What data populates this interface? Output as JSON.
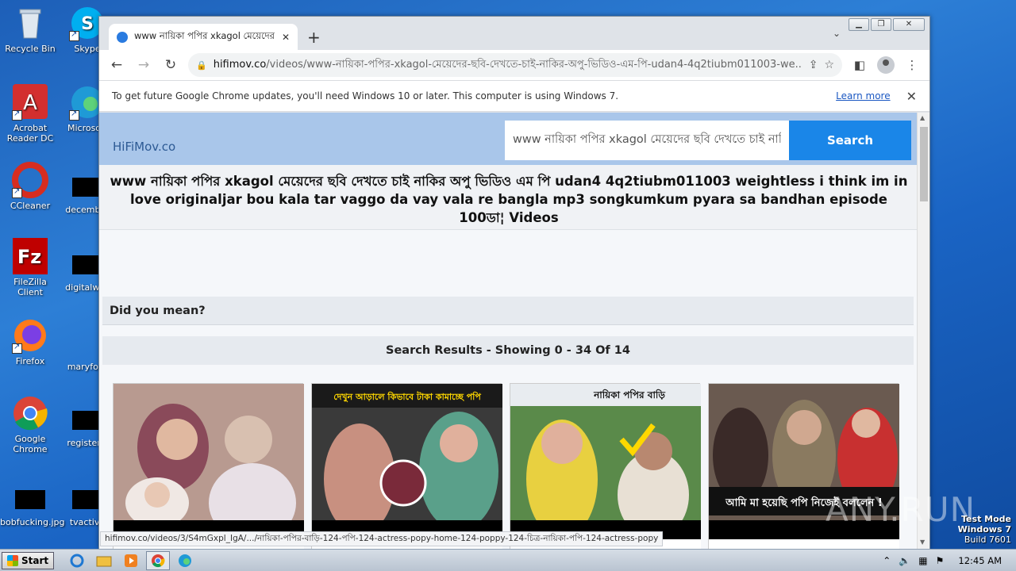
{
  "desktop": {
    "icons": [
      {
        "label": "Recycle Bin"
      },
      {
        "label": "Acrobat Reader DC"
      },
      {
        "label": "CCleaner"
      },
      {
        "label": "FileZilla Client"
      },
      {
        "label": "Firefox"
      },
      {
        "label": "Google Chrome"
      },
      {
        "label": "bobfucking.jpg"
      },
      {
        "label": "Skype"
      },
      {
        "label": "Microsoft"
      },
      {
        "label": "december"
      },
      {
        "label": "digitalwes"
      },
      {
        "label": "maryforu"
      },
      {
        "label": "registercl"
      },
      {
        "label": "tvactive"
      }
    ]
  },
  "browser": {
    "tab_title": "www নায়িকা পপির xkagol মেয়েদের ছবি দেখতে চাই নাকির",
    "tab_close": "✕",
    "new_tab": "+",
    "url_host": "hifimov.co",
    "url_path": "/videos/www-নায়িকা-পপির-xkagol-মেয়েদের-ছবি-দেখতে-চাই-নাকির-অপু-ভিডিও-এম-পি-udan4-4q2tiubm011003-we...",
    "infobar_text": "To get future Google Chrome updates, you'll need Windows 10 or later. This computer is using Windows 7.",
    "infobar_link": "Learn more",
    "status_url": "hifimov.co/videos/3/S4mGxpl_IgA/.../নায়িকা-পপির-বাড়ি-124-পপি-124-actress-popy-home-124-poppy-124-চিত্র-নায়িকা-পপি-124-actress-popy"
  },
  "site": {
    "logo": "HiFiMov.co",
    "search_value": "www নায়িকা পপির xkagol মেয়েদের ছবি দেখতে চাই নাকি",
    "search_button": "Search",
    "page_title": "www নায়িকা পপির xkagol মেয়েদের ছবি দেখতে চাই নাকির অপু ভিডিও এম পি udan4 4q2tiubm011003 weightless i think im in love originaljar bou kala tar vaggo da vay vala re bangla mp3 songkumkum pyara sa bandhan episode 100ডা¦ Videos",
    "did_you_mean": "Did you mean?",
    "results_header": "Search Results - Showing 0 - 34 Of 14",
    "thumbnails": [
      {
        "overlay": ""
      },
      {
        "overlay": "দেখুন আড়ালে কিভাবে টাকা কামাচ্ছে পপি"
      },
      {
        "overlay": "নায়িকা পপির বাড়ি"
      },
      {
        "overlay": "আমি মা হয়েছি পপি নিজেই বললেন !"
      }
    ]
  },
  "taskbar": {
    "start_label": "Start",
    "clock": "12:45 AM"
  },
  "overlay": {
    "watermark": "ANY.RUN",
    "test_mode": "Test Mode",
    "windows": "Windows 7",
    "build": "Build 7601"
  }
}
